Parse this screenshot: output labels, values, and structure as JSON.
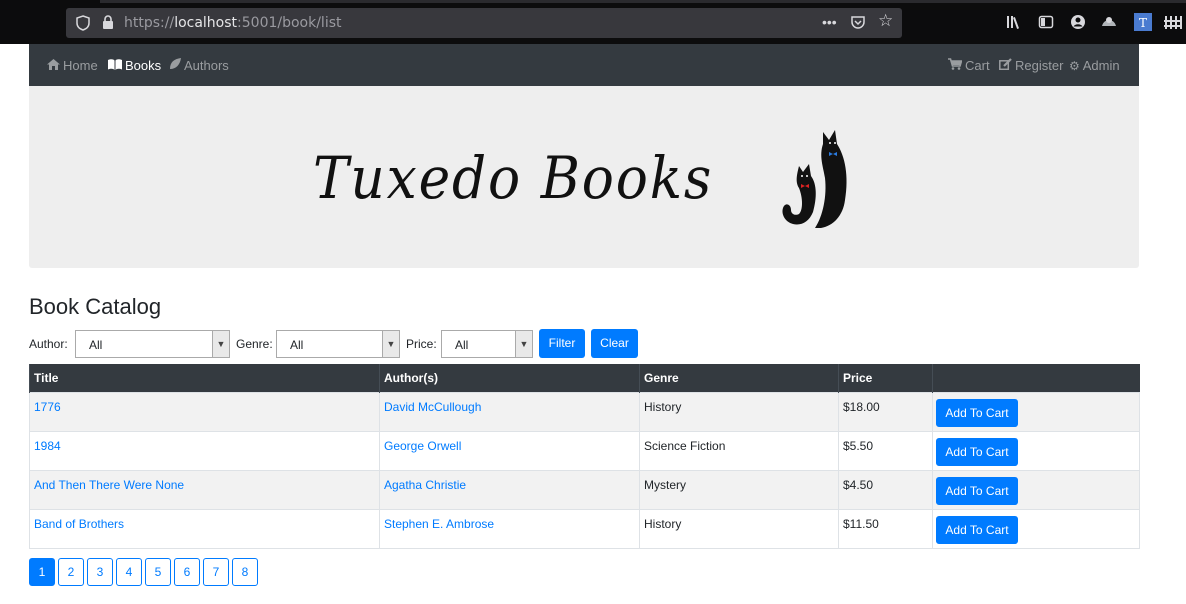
{
  "browser": {
    "url_scheme": "https://",
    "url_host": "localhost",
    "url_rest": ":5001/book/list"
  },
  "nav": {
    "left": [
      {
        "label": "Home",
        "icon": "home-icon"
      },
      {
        "label": "Books",
        "icon": "book-icon",
        "active": true
      },
      {
        "label": "Authors",
        "icon": "leaf-icon"
      }
    ],
    "right": [
      {
        "label": "Cart",
        "icon": "cart-icon"
      },
      {
        "label": "Register",
        "icon": "edit-icon"
      },
      {
        "label": "Admin",
        "icon": "gear-icon"
      }
    ]
  },
  "banner": {
    "logo_text": "Tuxedo Books"
  },
  "page_title": "Book Catalog",
  "filters": {
    "author_label": "Author:",
    "author_value": "All",
    "genre_label": "Genre:",
    "genre_value": "All",
    "price_label": "Price:",
    "price_value": "All",
    "filter_button": "Filter",
    "clear_button": "Clear"
  },
  "table": {
    "headers": [
      "Title",
      "Author(s)",
      "Genre",
      "Price",
      ""
    ],
    "rows": [
      {
        "title": "1776",
        "author": "David McCullough",
        "genre": "History",
        "price": "$18.00",
        "action": "Add To Cart"
      },
      {
        "title": "1984",
        "author": "George Orwell",
        "genre": "Science Fiction",
        "price": "$5.50",
        "action": "Add To Cart"
      },
      {
        "title": "And Then There Were None",
        "author": "Agatha Christie",
        "genre": "Mystery",
        "price": "$4.50",
        "action": "Add To Cart"
      },
      {
        "title": "Band of Brothers",
        "author": "Stephen E. Ambrose",
        "genre": "History",
        "price": "$11.50",
        "action": "Add To Cart"
      }
    ]
  },
  "pagination": {
    "pages": [
      "1",
      "2",
      "3",
      "4",
      "5",
      "6",
      "7",
      "8"
    ],
    "current": "1"
  },
  "colors": {
    "primary": "#007bff",
    "navbar": "#343a40",
    "banner": "#eeeeee"
  }
}
